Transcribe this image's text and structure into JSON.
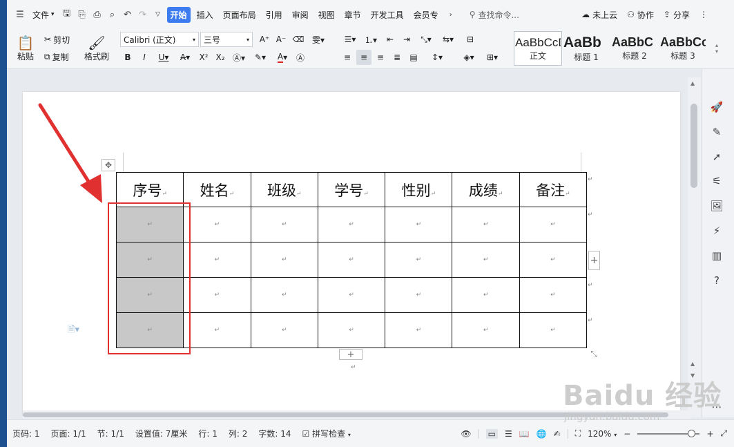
{
  "menubar": {
    "file_label": "文件",
    "tabs": [
      "开始",
      "插入",
      "页面布局",
      "引用",
      "审阅",
      "视图",
      "章节",
      "开发工具",
      "会员专"
    ],
    "search_placeholder": "查找命令...",
    "cloud_label": "未上云",
    "collab_label": "协作",
    "share_label": "分享"
  },
  "ribbon": {
    "paste_label": "粘贴",
    "cut_label": "剪切",
    "copy_label": "复制",
    "format_painter_label": "格式刷",
    "font_name": "Calibri (正文)",
    "font_size": "三号",
    "styles": [
      {
        "sample": "AaBbCcDd",
        "name": "正文"
      },
      {
        "sample": "AaBb",
        "name": "标题 1"
      },
      {
        "sample": "AaBbC",
        "name": "标题 2"
      },
      {
        "sample": "AaBbCc",
        "name": "标题 3"
      }
    ]
  },
  "table": {
    "headers": [
      "序号",
      "姓名",
      "班级",
      "学号",
      "性别",
      "成绩",
      "备注"
    ],
    "row_count": 4,
    "cell_mark": "↵",
    "highlighted_column": 0
  },
  "statusbar": {
    "page_num": "页码: 1",
    "pages": "页面: 1/1",
    "section": "节: 1/1",
    "setting": "设置值: 7厘米",
    "row": "行: 1",
    "col": "列: 2",
    "word_count": "字数: 14",
    "spell_check": "拼写检查",
    "zoom": "120%"
  },
  "watermark": {
    "brand": "Baidu 经验",
    "url": "jingyan.baidu.com"
  },
  "colors": {
    "accent": "#3c7cf0",
    "highlight_box": "#e03030",
    "cell_shade": "#c8c8c8"
  }
}
